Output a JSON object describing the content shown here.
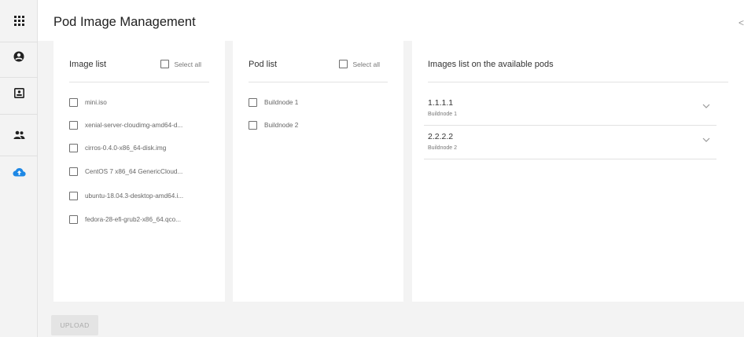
{
  "colors": {
    "accent": "#1e88e5",
    "sidebar_icon": "#212121"
  },
  "sidebar": {
    "items": [
      {
        "icon": "apps-grid-icon"
      },
      {
        "icon": "account-circle-icon"
      },
      {
        "icon": "account-box-icon"
      },
      {
        "icon": "group-icon"
      },
      {
        "icon": "cloud-upload-icon",
        "active": true
      }
    ]
  },
  "header": {
    "title": "Pod Image Management",
    "edge_text": "<"
  },
  "image_panel": {
    "title": "Image list",
    "select_all": "Select all",
    "items": [
      "mini.iso",
      "xenial-server-cloudimg-amd64-d...",
      "cirros-0.4.0-x86_64-disk.img",
      "CentOS 7 x86_64 GenericCloud...",
      "ubuntu-18.04.3-desktop-amd64.i...",
      "fedora-28-efi-grub2-x86_64.qco..."
    ]
  },
  "pod_panel": {
    "title": "Pod list",
    "select_all": "Select all",
    "items": [
      "Buildnode 1",
      "Buildnode 2"
    ]
  },
  "images_on_pods": {
    "title": "Images list on the available pods",
    "items": [
      {
        "ip": "1.1.1.1",
        "node": "Buildnode 1"
      },
      {
        "ip": "2.2.2.2",
        "node": "Buildnode 2"
      }
    ]
  },
  "upload_button": "UPLOAD"
}
